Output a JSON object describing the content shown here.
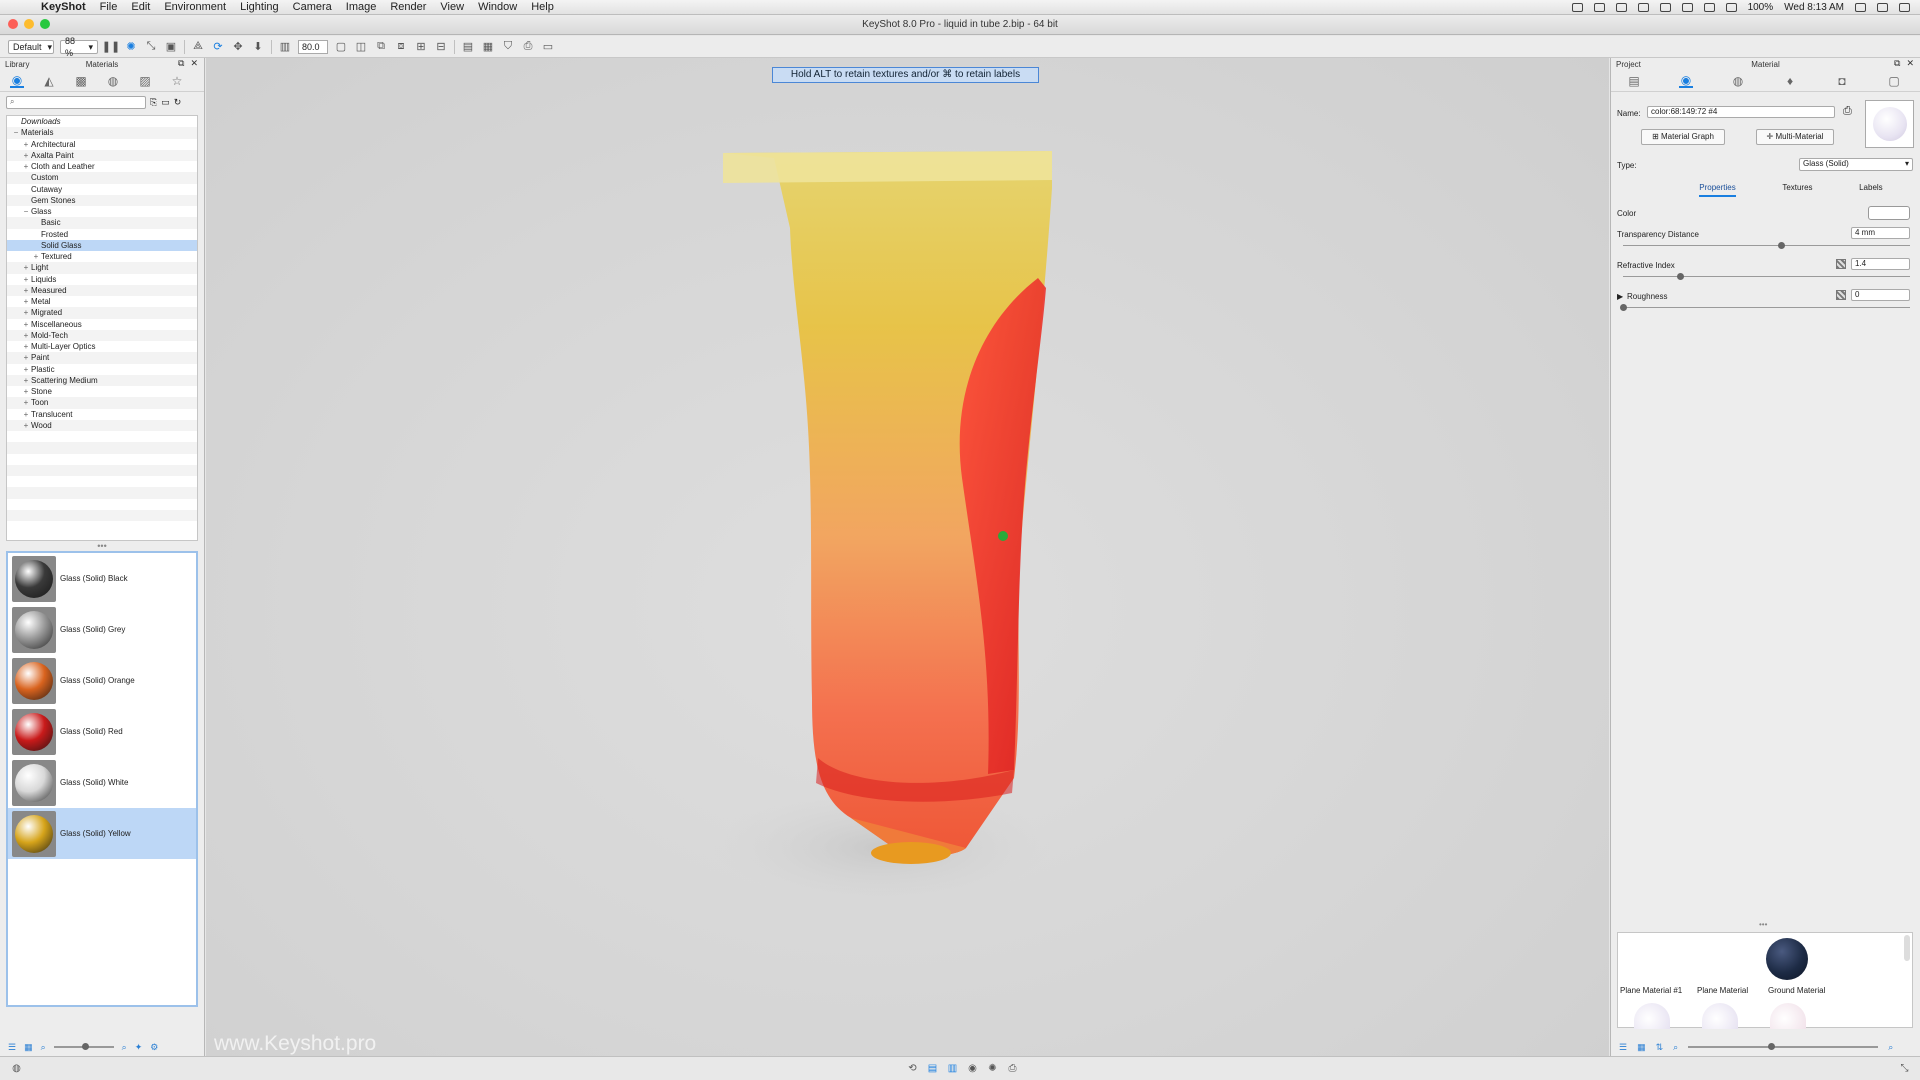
{
  "menubar": {
    "apple": "",
    "items": [
      "KeyShot",
      "File",
      "Edit",
      "Environment",
      "Lighting",
      "Camera",
      "Image",
      "Render",
      "View",
      "Window",
      "Help"
    ],
    "battery": "100%",
    "clock": "Wed 8:13 AM"
  },
  "window": {
    "title": "KeyShot 8.0 Pro  - liquid in tube 2.bip - 64 bit"
  },
  "toolbar": {
    "preset": "Default",
    "zoom": "88 %",
    "focal": "80.0"
  },
  "left_panel": {
    "title_left": "Library",
    "title_center": "Materials",
    "search_placeholder": "",
    "tree": [
      {
        "label": "Downloads",
        "level": 0,
        "exp": "",
        "italic": true
      },
      {
        "label": "Materials",
        "level": 0,
        "exp": "−"
      },
      {
        "label": "Architectural",
        "level": 1,
        "exp": "+"
      },
      {
        "label": "Axalta Paint",
        "level": 1,
        "exp": "+"
      },
      {
        "label": "Cloth and Leather",
        "level": 1,
        "exp": "+"
      },
      {
        "label": "Custom",
        "level": 1,
        "exp": ""
      },
      {
        "label": "Cutaway",
        "level": 1,
        "exp": ""
      },
      {
        "label": "Gem Stones",
        "level": 1,
        "exp": ""
      },
      {
        "label": "Glass",
        "level": 1,
        "exp": "−"
      },
      {
        "label": "Basic",
        "level": 2,
        "exp": ""
      },
      {
        "label": "Frosted",
        "level": 2,
        "exp": ""
      },
      {
        "label": "Solid Glass",
        "level": 2,
        "exp": "",
        "selected": true
      },
      {
        "label": "Textured",
        "level": 2,
        "exp": "+"
      },
      {
        "label": "Light",
        "level": 1,
        "exp": "+"
      },
      {
        "label": "Liquids",
        "level": 1,
        "exp": "+"
      },
      {
        "label": "Measured",
        "level": 1,
        "exp": "+"
      },
      {
        "label": "Metal",
        "level": 1,
        "exp": "+"
      },
      {
        "label": "Migrated",
        "level": 1,
        "exp": "+"
      },
      {
        "label": "Miscellaneous",
        "level": 1,
        "exp": "+"
      },
      {
        "label": "Mold-Tech",
        "level": 1,
        "exp": "+"
      },
      {
        "label": "Multi-Layer Optics",
        "level": 1,
        "exp": "+"
      },
      {
        "label": "Paint",
        "level": 1,
        "exp": "+"
      },
      {
        "label": "Plastic",
        "level": 1,
        "exp": "+"
      },
      {
        "label": "Scattering Medium",
        "level": 1,
        "exp": "+"
      },
      {
        "label": "Stone",
        "level": 1,
        "exp": "+"
      },
      {
        "label": "Toon",
        "level": 1,
        "exp": "+"
      },
      {
        "label": "Translucent",
        "level": 1,
        "exp": "+"
      },
      {
        "label": "Wood",
        "level": 1,
        "exp": "+"
      }
    ],
    "thumbnails": [
      {
        "label": "Glass (Solid) Black",
        "color": "#3a3a3a"
      },
      {
        "label": "Glass (Solid) Grey",
        "color": "#9a9a9a"
      },
      {
        "label": "Glass (Solid) Orange",
        "color": "#d9631e"
      },
      {
        "label": "Glass (Solid) Red",
        "color": "#c91a1a"
      },
      {
        "label": "Glass (Solid) White",
        "color": "#d8d8d8"
      },
      {
        "label": "Glass (Solid) Yellow",
        "color": "#d6a41a",
        "selected": true
      }
    ]
  },
  "viewport": {
    "hint": "Hold ALT to retain textures and/or ⌘ to retain labels",
    "watermark": "www.Keyshot.pro"
  },
  "right_panel": {
    "title_left": "Project",
    "title_center": "Material",
    "name_label": "Name:",
    "name_value": "color:68:149:72 #4",
    "material_graph": "Material Graph",
    "multi_material": "Multi-Material",
    "type_label": "Type:",
    "type_value": "Glass (Solid)",
    "tabs": [
      "Properties",
      "Textures",
      "Labels"
    ],
    "color_label": "Color",
    "transparency_label": "Transparency Distance",
    "transparency_value": "4 mm",
    "transparency_fraction": 0.55,
    "refractive_label": "Refractive Index",
    "refractive_value": "1.4",
    "refractive_fraction": 0.2,
    "roughness_label": "Roughness",
    "roughness_value": "0",
    "roughness_fraction": 0.0,
    "project_materials": [
      {
        "label": "Plane Material #1",
        "color": "#ece8f4"
      },
      {
        "label": "Plane Material",
        "color": "#ece8f4"
      },
      {
        "label": "Ground Material",
        "color": "#1d2b45"
      }
    ]
  },
  "colors": {
    "accent": "#1a7fe0",
    "selection": "#bdd7f6"
  }
}
